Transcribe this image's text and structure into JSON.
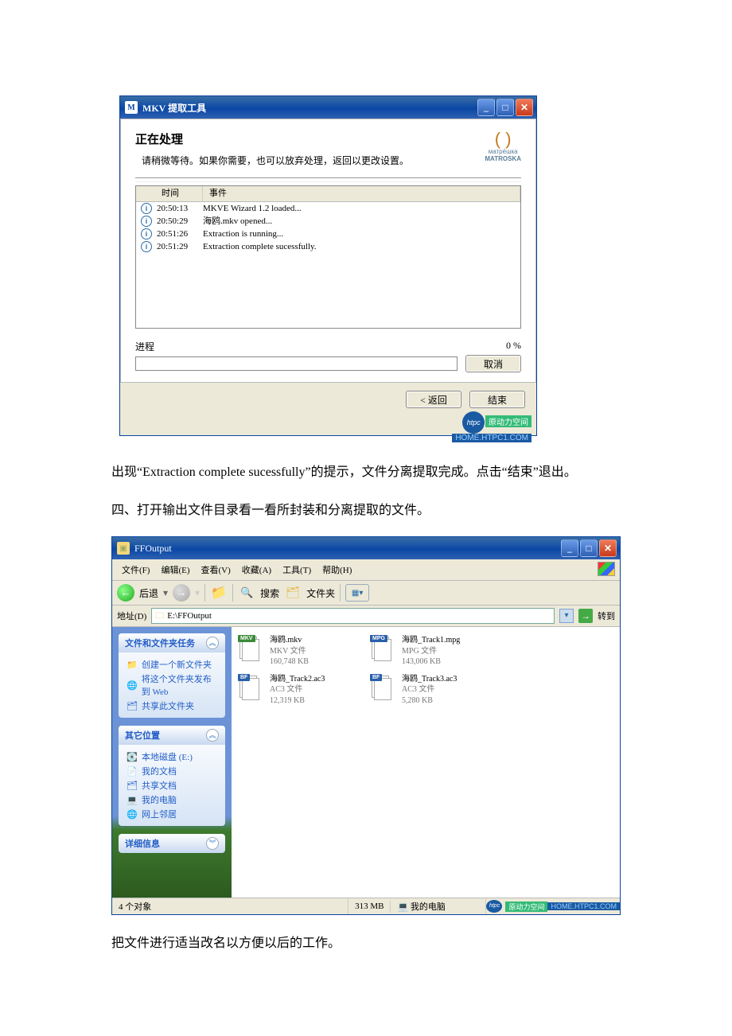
{
  "w1": {
    "title": "MKV 提取工具",
    "heading": "正在处理",
    "subtext": "请稍微等待。如果你需要，也可以放弃处理，返回以更改设置。",
    "matroska_brand_1": "матрёшка",
    "matroska_brand_2": "MATROSKA",
    "log_header_time": "时间",
    "log_header_event": "事件",
    "log": [
      {
        "t": "20:50:13",
        "e": "MKVE Wizard 1.2 loaded..."
      },
      {
        "t": "20:50:29",
        "e": "海鸥.mkv opened..."
      },
      {
        "t": "20:51:26",
        "e": "Extraction is running..."
      },
      {
        "t": "20:51:29",
        "e": "Extraction complete sucessfully."
      }
    ],
    "progress_label": "进程",
    "progress_pct": "0 %",
    "cancel": "取消",
    "back": "< 返回",
    "finish": "结束",
    "wm_top": "原动力空间",
    "wm_bottom": "HOME.HTPC1.COM"
  },
  "text1": "出现“Extraction complete sucessfully”的提示，文件分离提取完成。点击“结束”退出。",
  "text2": "四、打开输出文件目录看一看所封装和分离提取的文件。",
  "text3": "把文件进行适当改名以方便以后的工作。",
  "w2": {
    "title": "FFOutput",
    "menu": [
      "文件(F)",
      "编辑(E)",
      "查看(V)",
      "收藏(A)",
      "工具(T)",
      "帮助(H)"
    ],
    "tb_back": "后退",
    "tb_search": "搜索",
    "tb_folders": "文件夹",
    "addr_label": "地址(D)",
    "addr_value": "E:\\FFOutput",
    "go": "转到",
    "panel1_title": "文件和文件夹任务",
    "panel1_items": [
      "创建一个新文件夹",
      "将这个文件夹发布到 Web",
      "共享此文件夹"
    ],
    "panel2_title": "其它位置",
    "panel2_items": [
      "本地磁盘 (E:)",
      "我的文档",
      "共享文档",
      "我的电脑",
      "网上邻居"
    ],
    "panel3_title": "详细信息",
    "files": [
      {
        "badge": "MKV",
        "cls": "mkv",
        "name": "海鸥.mkv",
        "type": "MKV 文件",
        "size": "160,748 KB"
      },
      {
        "badge": "MPG",
        "cls": "mpg",
        "name": "海鸥_Track1.mpg",
        "type": "MPG 文件",
        "size": "143,006 KB"
      },
      {
        "badge": "BF",
        "cls": "ac3",
        "name": "海鸥_Track2.ac3",
        "type": "AC3 文件",
        "size": "12,319 KB"
      },
      {
        "badge": "BF",
        "cls": "ac3",
        "name": "海鸥_Track3.ac3",
        "type": "AC3 文件",
        "size": "5,280 KB"
      }
    ],
    "status_count": "4 个对象",
    "status_size": "313 MB",
    "status_loc": "我的电脑"
  }
}
